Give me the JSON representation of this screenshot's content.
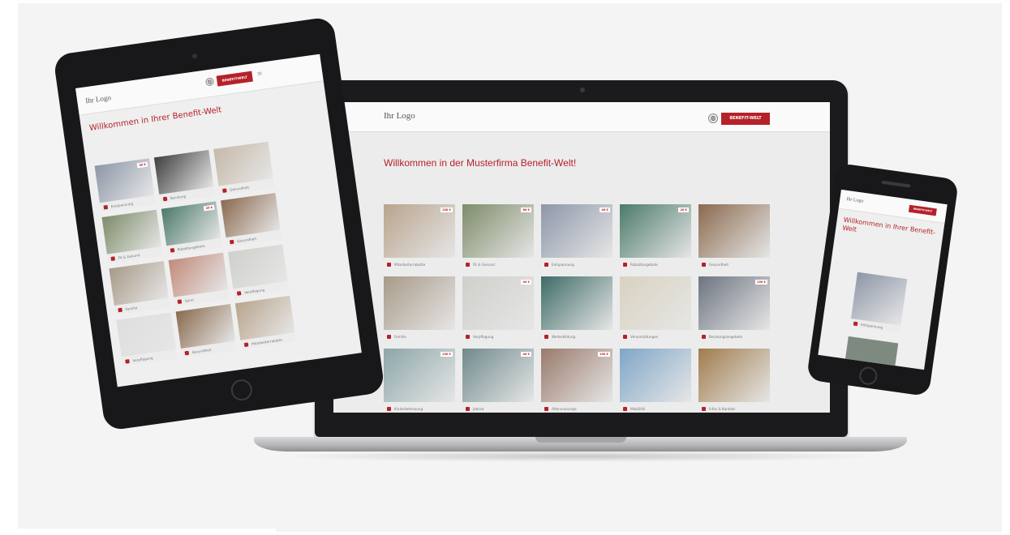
{
  "brand": {
    "accent": "#b52129"
  },
  "laptop": {
    "logo": "Ihr Logo",
    "globe_icon": "globe-icon",
    "button_label": "BENEFIT-WELT",
    "title": "Willkommen in der Musterfirma Benefit-Welt!",
    "intro": "",
    "tiles": [
      {
        "label": "Mitarbeiterrabatte",
        "price": "150 €",
        "icon": "gift-icon",
        "color": "#b8a48c"
      },
      {
        "label": "Fit & Gesund",
        "price": "80 €",
        "icon": "heart-icon",
        "color": "#7d8c69"
      },
      {
        "label": "Entspannung",
        "price": "40 €",
        "icon": "moon-icon",
        "color": "#8d97a8"
      },
      {
        "label": "Rabattangebote",
        "price": "20 €",
        "icon": "percent-icon",
        "color": "#4c7a6a"
      },
      {
        "label": "Gesundheit",
        "price": "",
        "icon": "heart-icon",
        "color": "#8a6a4e"
      },
      {
        "label": "Familie",
        "price": "",
        "icon": "family-icon",
        "color": "#a89a88"
      },
      {
        "label": "Verpflegung",
        "price": "40 €",
        "icon": "fork-icon",
        "color": "#cfcfcb"
      },
      {
        "label": "Weiterbildung",
        "price": "",
        "icon": "book-icon",
        "color": "#3e6b66"
      },
      {
        "label": "Veranstaltungen",
        "price": "",
        "icon": "glass-icon",
        "color": "#d8d2c0"
      },
      {
        "label": "Beratungsangebote",
        "price": "150 €",
        "icon": "chat-icon",
        "color": "#6c7480"
      },
      {
        "label": "Kinderbetreuung",
        "price": "150 €",
        "icon": "child-icon",
        "color": "#8ca6a8"
      },
      {
        "label": "Jobrad",
        "price": "40 €",
        "icon": "bike-icon",
        "color": "#6f8a8c"
      },
      {
        "label": "Altersvorsorge",
        "price": "150 €",
        "icon": "umbrella-icon",
        "color": "#9a7a6a"
      },
      {
        "label": "Mobilität",
        "price": "",
        "icon": "car-icon",
        "color": "#7fa6c8"
      },
      {
        "label": "Infos & Kontakt",
        "price": "",
        "icon": "pin-icon",
        "color": "#a07c4c"
      }
    ]
  },
  "tablet": {
    "logo": "Ihr Logo",
    "button_label": "BENEFIT-WELT",
    "menu_icon": "menu-icon",
    "title": "Willkommen in Ihrer Benefit-Welt",
    "intro": "",
    "tiles": [
      {
        "label": "Entspannung",
        "price": "40 €",
        "color": "#8d97a8"
      },
      {
        "label": "Beratung",
        "price": "",
        "color": "#3f3f3f"
      },
      {
        "label": "Gesundheit",
        "price": "",
        "color": "#c5b9a8"
      },
      {
        "label": "Fit & Gesund",
        "price": "",
        "color": "#7d8c69"
      },
      {
        "label": "Rabattangebote",
        "price": "20 €",
        "color": "#4c7a6a"
      },
      {
        "label": "Gesundheit",
        "price": "",
        "color": "#8a6a4e"
      },
      {
        "label": "Familie",
        "price": "",
        "color": "#a89a88"
      },
      {
        "label": "Sport",
        "price": "",
        "color": "#c28a7a"
      },
      {
        "label": "Verpflegung",
        "price": "",
        "color": "#cfcfcb"
      },
      {
        "label": "Verpflegung",
        "price": "",
        "color": "#dedede"
      },
      {
        "label": "Gesundheit",
        "price": "",
        "color": "#8a6a4e"
      },
      {
        "label": "Mitarbeiterrabatte",
        "price": "",
        "color": "#b8a48c"
      }
    ]
  },
  "phone": {
    "logo": "Ihr Logo",
    "button_label": "BENEFIT-WELT",
    "title": "Willkommen in Ihrer Benefit-Welt",
    "intro": "",
    "tile": {
      "label": "Entspannung",
      "price": "",
      "color": "#8d97a8"
    }
  }
}
